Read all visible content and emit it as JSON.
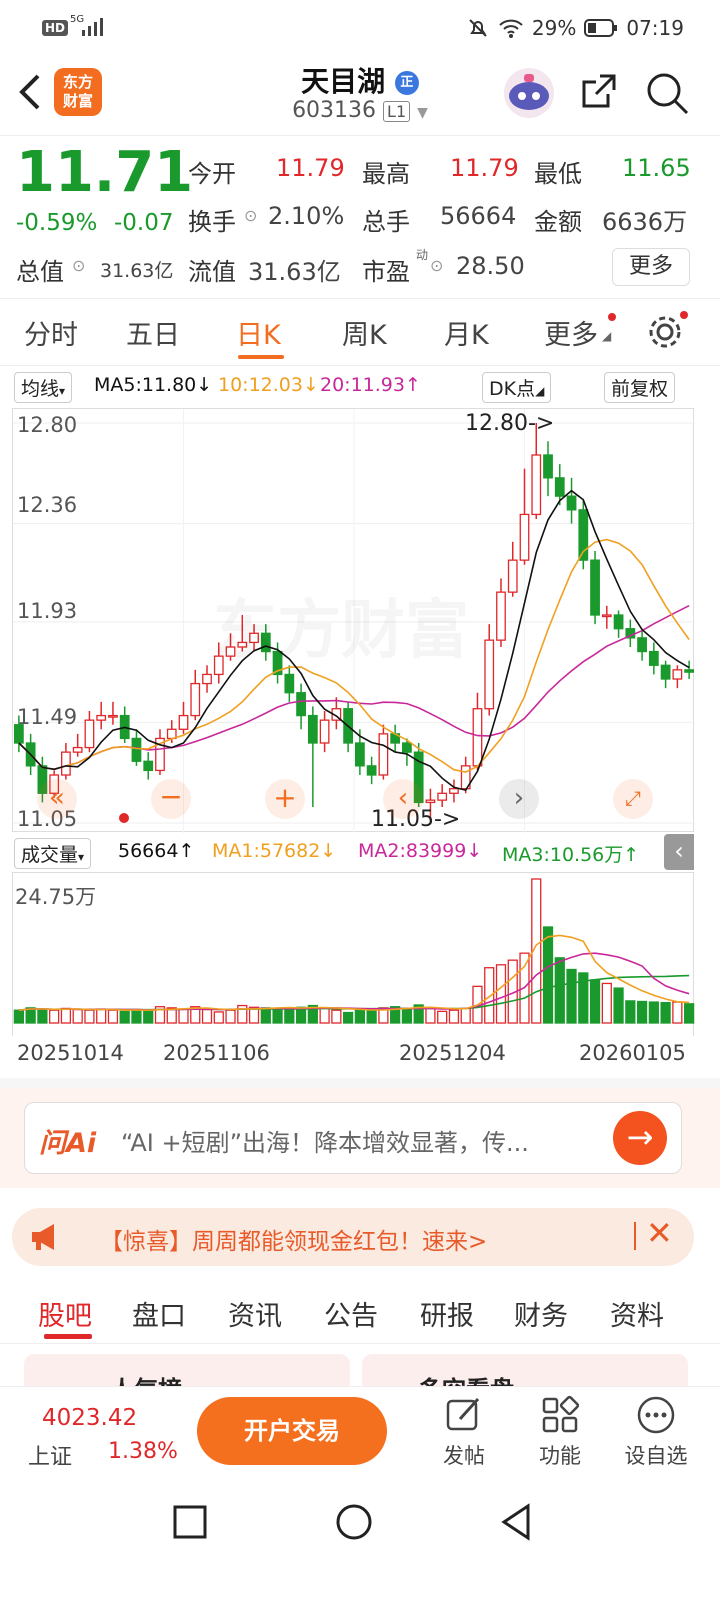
{
  "status_bar": {
    "hd": "HD",
    "network": "5G",
    "battery_pct": "29%",
    "time": "07:19"
  },
  "header": {
    "logo_line1": "东方",
    "logo_line2": "财富",
    "name": "天目湖",
    "badge": "正",
    "code": "603136",
    "code_tag": "L1"
  },
  "quote": {
    "price": "11.71",
    "change_pct": "-0.59%",
    "change": "-0.07",
    "open_label": "今开",
    "open": "11.79",
    "high_label": "最高",
    "high": "11.79",
    "low_label": "最低",
    "low": "11.65",
    "turnover_label": "换手",
    "turnover": "2.10%",
    "volume_label": "总手",
    "volume": "56664",
    "amount_label": "金额",
    "amount": "6636万",
    "total_mv_label": "总值",
    "total_mv": "31.63亿",
    "float_mv_label": "流值",
    "float_mv": "31.63亿",
    "pe_label": "市盈",
    "pe_sup": "动",
    "pe": "28.50",
    "more": "更多"
  },
  "tabs": [
    "分时",
    "五日",
    "日K",
    "周K",
    "月K",
    "更多"
  ],
  "active_tab": "日K",
  "chart_toolbar": {
    "indicator": "均线",
    "ma5": "MA5:11.80↓",
    "ma10": "10:12.03↓",
    "ma20": "20:11.93↑",
    "dk": "DK点",
    "adjust": "前复权"
  },
  "volume_toolbar": {
    "indicator": "成交量",
    "vol": "56664↑",
    "ma1": "MA1:57682↓",
    "ma2": "MA2:83999↓",
    "ma3": "MA3:10.56万↑"
  },
  "watermark": "东方财富",
  "colors": {
    "up": "#e0272a",
    "down": "#1a9a2c",
    "accent": "#f26d1f",
    "ma5": "#111111",
    "ma10": "#f0a020",
    "ma20": "#c8289a"
  },
  "chart_data": [
    {
      "type": "candlestick",
      "y_ticks": [
        "12.80",
        "12.36",
        "11.93",
        "11.49",
        "11.05"
      ],
      "ylim": [
        11.05,
        12.8
      ],
      "max_marker": "12.80->",
      "min_marker": "11.05->",
      "x": [
        1,
        2,
        3,
        4,
        5,
        6,
        7,
        8,
        9,
        10,
        11,
        12,
        13,
        14,
        15,
        16,
        17,
        18,
        19,
        20,
        21,
        22,
        23,
        24,
        25,
        26,
        27,
        28,
        29,
        30,
        31,
        32,
        33,
        34,
        35,
        36,
        37,
        38,
        39,
        40,
        41,
        42,
        43,
        44,
        45,
        46,
        47,
        48,
        49,
        50,
        51,
        52,
        53,
        54,
        55,
        56,
        57,
        58
      ],
      "open": [
        11.48,
        11.4,
        11.3,
        11.18,
        11.26,
        11.36,
        11.38,
        11.5,
        11.52,
        11.52,
        11.42,
        11.32,
        11.28,
        11.42,
        11.46,
        11.52,
        11.66,
        11.7,
        11.78,
        11.82,
        11.84,
        11.88,
        11.8,
        11.7,
        11.62,
        11.52,
        11.4,
        11.5,
        11.55,
        11.4,
        11.3,
        11.26,
        11.44,
        11.4,
        11.36,
        11.14,
        11.15,
        11.18,
        11.2,
        11.3,
        11.55,
        11.85,
        12.06,
        12.2,
        12.4,
        12.66,
        12.56,
        12.48,
        12.42,
        12.2,
        11.96,
        11.96,
        11.9,
        11.86,
        11.8,
        11.74,
        11.68,
        11.72
      ],
      "close": [
        11.4,
        11.3,
        11.18,
        11.26,
        11.36,
        11.38,
        11.5,
        11.52,
        11.52,
        11.42,
        11.32,
        11.28,
        11.42,
        11.46,
        11.52,
        11.66,
        11.7,
        11.78,
        11.82,
        11.84,
        11.88,
        11.8,
        11.7,
        11.62,
        11.52,
        11.4,
        11.5,
        11.55,
        11.4,
        11.3,
        11.26,
        11.44,
        11.4,
        11.36,
        11.14,
        11.15,
        11.18,
        11.2,
        11.3,
        11.55,
        11.85,
        12.06,
        12.2,
        12.4,
        12.66,
        12.56,
        12.48,
        12.42,
        12.2,
        11.96,
        11.96,
        11.9,
        11.86,
        11.8,
        11.74,
        11.68,
        11.72,
        11.71
      ],
      "high": [
        11.52,
        11.44,
        11.34,
        11.28,
        11.4,
        11.44,
        11.54,
        11.58,
        11.58,
        11.56,
        11.46,
        11.36,
        11.46,
        11.5,
        11.58,
        11.72,
        11.74,
        11.84,
        11.88,
        11.96,
        11.92,
        11.92,
        11.84,
        11.74,
        11.66,
        11.56,
        11.54,
        11.6,
        11.58,
        11.46,
        11.34,
        11.48,
        11.48,
        11.42,
        11.4,
        11.2,
        11.22,
        11.24,
        11.34,
        11.62,
        11.92,
        12.12,
        12.28,
        12.6,
        12.8,
        12.72,
        12.62,
        12.56,
        12.46,
        12.24,
        12.0,
        11.98,
        11.94,
        11.9,
        11.84,
        11.76,
        11.74,
        11.76
      ],
      "low": [
        11.36,
        11.26,
        11.14,
        11.16,
        11.24,
        11.34,
        11.36,
        11.46,
        11.48,
        11.4,
        11.3,
        11.24,
        11.26,
        11.4,
        11.44,
        11.5,
        11.62,
        11.66,
        11.76,
        11.8,
        11.8,
        11.76,
        11.66,
        11.58,
        11.46,
        11.12,
        11.36,
        11.46,
        11.36,
        11.26,
        11.22,
        11.24,
        11.36,
        11.3,
        11.12,
        11.05,
        11.12,
        11.14,
        11.18,
        11.28,
        11.52,
        11.82,
        12.04,
        12.18,
        12.38,
        12.48,
        12.44,
        12.36,
        12.16,
        11.92,
        11.9,
        11.86,
        11.82,
        11.76,
        11.7,
        11.64,
        11.64,
        11.68
      ]
    },
    {
      "type": "bar",
      "title": "成交量",
      "y_ticks": [
        "24.75万"
      ],
      "x_ticks": [
        "20251014",
        "20251106",
        "20251204",
        "20260105"
      ],
      "values": [
        2.2,
        2.6,
        2.4,
        2.2,
        2.5,
        2.3,
        2.2,
        2.4,
        2.2,
        2.0,
        2.3,
        2.1,
        2.8,
        2.6,
        2.4,
        2.8,
        2.3,
        1.9,
        2.2,
        3.0,
        2.7,
        2.6,
        2.5,
        2.4,
        2.7,
        3.0,
        2.6,
        2.2,
        1.8,
        2.2,
        2.4,
        2.6,
        2.8,
        2.5,
        3.1,
        2.5,
        2.0,
        2.2,
        2.5,
        6.3,
        9.5,
        10.0,
        10.8,
        12.0,
        24.75,
        16.5,
        11.2,
        9.2,
        8.6,
        7.4,
        6.8,
        6.0,
        3.8,
        3.7,
        3.6,
        3.5,
        3.6,
        3.3
      ]
    }
  ],
  "ai_bar": {
    "logo": "问Ai",
    "placeholder": "“AI +短剧”出海！降本增效显著，传..."
  },
  "promo": {
    "text": "【惊喜】周周都能领现金红包！速来>"
  },
  "sub_tabs": [
    "股吧",
    "盘口",
    "资讯",
    "公告",
    "研报",
    "财务",
    "资料"
  ],
  "peek_cards": [
    "人气榜",
    "多空看盘"
  ],
  "bottom": {
    "index_value": "4023.42",
    "index_name": "上证",
    "index_change": "1.38%",
    "trade_button": "开户交易",
    "post": "发帖",
    "functions": "功能",
    "watchlist": "设自选"
  }
}
